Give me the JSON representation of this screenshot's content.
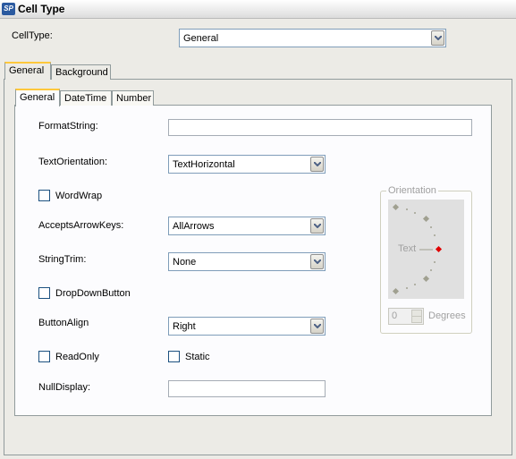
{
  "window": {
    "title": "Cell Type"
  },
  "celltype": {
    "label": "CellType:",
    "value": "General"
  },
  "outer_tabs": [
    "General",
    "Background"
  ],
  "inner_tabs": [
    "General",
    "DateTime",
    "Number"
  ],
  "form": {
    "format_string": {
      "label": "FormatString:",
      "value": ""
    },
    "text_orientation": {
      "label": "TextOrientation:",
      "value": "TextHorizontal"
    },
    "word_wrap": {
      "label": "WordWrap",
      "checked": false
    },
    "accepts_arrow_keys": {
      "label": "AcceptsArrowKeys:",
      "value": "AllArrows"
    },
    "string_trim": {
      "label": "StringTrim:",
      "value": "None"
    },
    "drop_down_button": {
      "label": "DropDownButton",
      "checked": false
    },
    "button_align": {
      "label": "ButtonAlign",
      "value": "Right"
    },
    "read_only": {
      "label": "ReadOnly",
      "checked": false
    },
    "static": {
      "label": "Static",
      "checked": false
    },
    "null_display": {
      "label": "NullDisplay:",
      "value": ""
    }
  },
  "orientation": {
    "title": "Orientation",
    "preview_text": "Text",
    "degrees_value": "0",
    "degrees_label": "Degrees"
  },
  "colors": {
    "tab_highlight": "#ffc83c",
    "input_border": "#7f9db9",
    "orientation_marker": "#e00000"
  }
}
